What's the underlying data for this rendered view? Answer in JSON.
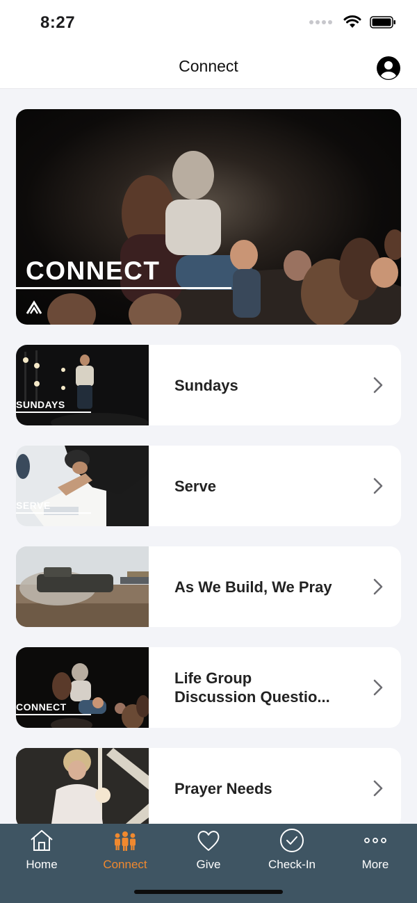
{
  "status": {
    "time": "8:27"
  },
  "header": {
    "title": "Connect"
  },
  "hero": {
    "overlay_text": "CONNECT"
  },
  "items": [
    {
      "label": "Sundays",
      "thumb_text": "SUNDAYS"
    },
    {
      "label": "Serve",
      "thumb_text": "SERVE"
    },
    {
      "label": "As We Build, We Pray",
      "thumb_text": ""
    },
    {
      "label": "Life Group\nDiscussion Questio...",
      "thumb_text": "CONNECT"
    },
    {
      "label": "Prayer Needs",
      "thumb_text": ""
    }
  ],
  "tabs": [
    {
      "label": "Home",
      "icon": "home-icon",
      "active": false
    },
    {
      "label": "Connect",
      "icon": "people-icon",
      "active": true
    },
    {
      "label": "Give",
      "icon": "heart-icon",
      "active": false
    },
    {
      "label": "Check-In",
      "icon": "checkmark-circle-icon",
      "active": false
    },
    {
      "label": "More",
      "icon": "ellipsis-icon",
      "active": false
    }
  ],
  "colors": {
    "accent": "#f0892f",
    "tab_bar": "#3f5563",
    "background": "#f3f4f8"
  }
}
